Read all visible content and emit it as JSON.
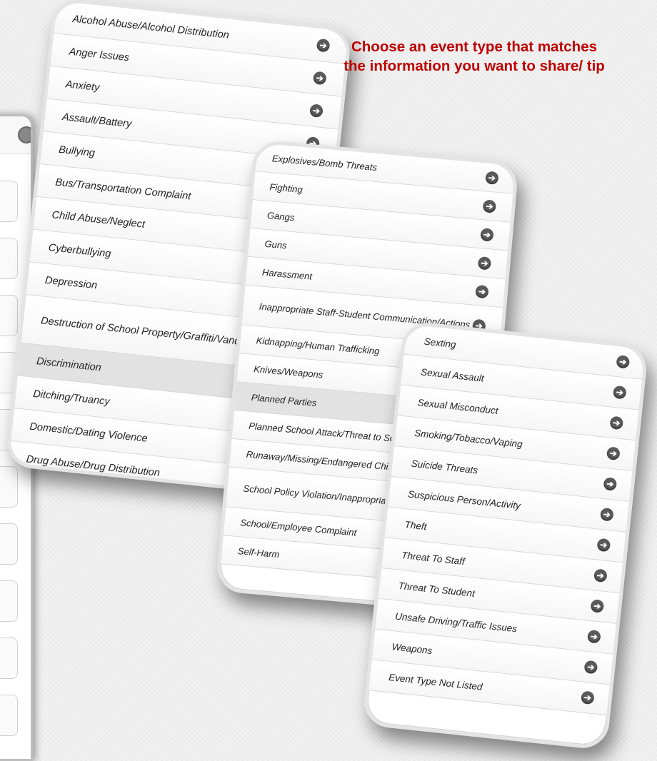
{
  "instruction": "Choose an event type that matches the information you want to share/ tip",
  "phone1": {
    "items": [
      {
        "label": "Alcohol Abuse/Alcohol Distribution",
        "highlighted": false
      },
      {
        "label": "Anger Issues",
        "highlighted": false
      },
      {
        "label": "Anxiety",
        "highlighted": false
      },
      {
        "label": "Assault/Battery",
        "highlighted": false
      },
      {
        "label": "Bullying",
        "highlighted": false
      },
      {
        "label": "Bus/Transportation Complaint",
        "highlighted": false
      },
      {
        "label": "Child Abuse/Neglect",
        "highlighted": false
      },
      {
        "label": "Cyberbullying",
        "highlighted": false
      },
      {
        "label": "Depression",
        "highlighted": false
      },
      {
        "label": "Destruction of School Property/Graffiti/Vandalism",
        "highlighted": false
      },
      {
        "label": "Discrimination",
        "highlighted": true
      },
      {
        "label": "Ditching/Truancy",
        "highlighted": false
      },
      {
        "label": "Domestic/Dating Violence",
        "highlighted": false
      },
      {
        "label": "Drug Abuse/Drug Distribution",
        "highlighted": false
      }
    ]
  },
  "phone2": {
    "items": [
      {
        "label": "Explosives/Bomb Threats",
        "highlighted": false
      },
      {
        "label": "Fighting",
        "highlighted": false
      },
      {
        "label": "Gangs",
        "highlighted": false
      },
      {
        "label": "Guns",
        "highlighted": false
      },
      {
        "label": "Harassment",
        "highlighted": false
      },
      {
        "label": "Inappropriate Staff-Student Communication/Actions",
        "highlighted": false
      },
      {
        "label": "Kidnapping/Human Trafficking",
        "highlighted": false
      },
      {
        "label": "Knives/Weapons",
        "highlighted": false
      },
      {
        "label": "Planned Parties",
        "highlighted": true
      },
      {
        "label": "Planned School Attack/Threat to School",
        "highlighted": false
      },
      {
        "label": "Runaway/Missing/Endangered Child",
        "highlighted": false
      },
      {
        "label": "School Policy Violation/Inappropriate Behavior",
        "highlighted": false
      },
      {
        "label": "School/Employee Complaint",
        "highlighted": false
      },
      {
        "label": "Self-Harm",
        "highlighted": false
      }
    ]
  },
  "phone3": {
    "items": [
      {
        "label": "Sexting",
        "highlighted": false
      },
      {
        "label": "Sexual Assault",
        "highlighted": false
      },
      {
        "label": "Sexual Misconduct",
        "highlighted": false
      },
      {
        "label": "Smoking/Tobacco/Vaping",
        "highlighted": false
      },
      {
        "label": "Suicide Threats",
        "highlighted": false
      },
      {
        "label": "Suspicious Person/Activity",
        "highlighted": false
      },
      {
        "label": "Theft",
        "highlighted": false
      },
      {
        "label": "Threat To Staff",
        "highlighted": false
      },
      {
        "label": "Threat To Student",
        "highlighted": false
      },
      {
        "label": "Unsafe Driving/Traffic Issues",
        "highlighted": false
      },
      {
        "label": "Weapons",
        "highlighted": false
      },
      {
        "label": "Event Type Not Listed",
        "highlighted": false
      }
    ]
  },
  "colors": {
    "instruction": "#c00000",
    "highlight_row": "#e2e2e2",
    "arrow_icon": "#5a5a5a"
  },
  "icons": {
    "row_arrow": "arrow-right-circle-icon",
    "left_phone_button": "home-button-icon"
  }
}
